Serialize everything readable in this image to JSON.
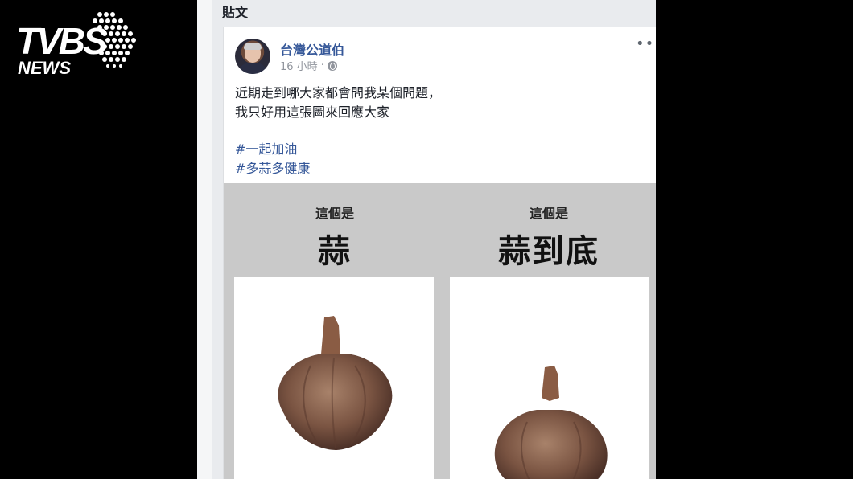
{
  "logo": {
    "brand": "TVBS",
    "sub": "NEWS"
  },
  "page": {
    "section_title": "貼文"
  },
  "post": {
    "author": "台灣公道伯",
    "time": "16 小時",
    "separator": "·",
    "more": "•••",
    "lines": [
      "近期走到哪大家都會問我某個問題，",
      "我只好用這張圖來回應大家"
    ],
    "hashtags": [
      "#一起加油",
      "#多蒜多健康"
    ],
    "image": {
      "left": {
        "caption": "這個是",
        "title": "蒜"
      },
      "right": {
        "caption": "這個是",
        "title": "蒜到底"
      }
    }
  }
}
